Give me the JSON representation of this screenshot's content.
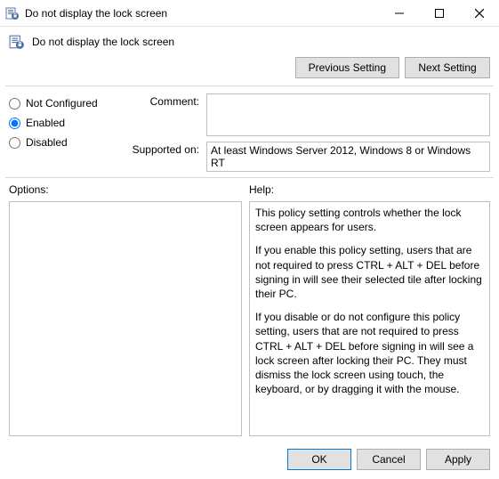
{
  "window": {
    "title": "Do not display the lock screen"
  },
  "header": {
    "title": "Do not display the lock screen"
  },
  "nav": {
    "previous": "Previous Setting",
    "next": "Next Setting"
  },
  "state": {
    "not_configured_label": "Not Configured",
    "enabled_label": "Enabled",
    "disabled_label": "Disabled",
    "selected": "enabled"
  },
  "fields": {
    "comment_label": "Comment:",
    "comment_value": "",
    "supported_label": "Supported on:",
    "supported_value": "At least Windows Server 2012, Windows 8 or Windows RT"
  },
  "sections": {
    "options_label": "Options:",
    "help_label": "Help:"
  },
  "help": {
    "p1": "This policy setting controls whether the lock screen appears for users.",
    "p2": "If you enable this policy setting, users that are not required to press CTRL + ALT + DEL before signing in will see their selected tile after locking their PC.",
    "p3": "If you disable or do not configure this policy setting, users that are not required to press CTRL + ALT + DEL before signing in will see a lock screen after locking their PC. They must dismiss the lock screen using touch, the keyboard, or by dragging it with the mouse."
  },
  "footer": {
    "ok": "OK",
    "cancel": "Cancel",
    "apply": "Apply"
  }
}
